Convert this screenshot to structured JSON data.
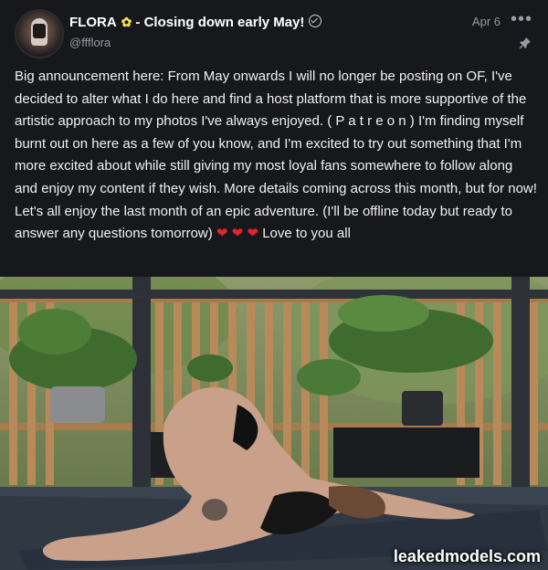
{
  "post": {
    "display_name": "FLORA",
    "display_name_suffix": "- Closing down early May!",
    "handle": "@ffflora",
    "date": "Apr 6",
    "body": "Big announcement here: From May onwards I will no longer be posting on OF, I've decided to alter what I do here and find a host platform that is more supportive of the artistic approach to my photos I've always enjoyed. ( P a t r e o n ) I'm finding myself burnt out on here as a few of you know, and I'm excited to try out something that I'm more excited about while still giving my most loyal fans somewhere to follow along and enjoy my content if they wish. More details coming across this month, but for now! Let's all enjoy the last month of an epic adventure. (I'll be offline today but ready to answer any questions tomorrow)",
    "body_end": "Love to you all",
    "flower_icon": "flower-emoji",
    "heart_icon": "red-heart-emoji"
  },
  "media": {
    "watermark": "leakedmodels.com"
  },
  "colors": {
    "background": "#17181c",
    "muted_text": "#9a9ba2",
    "heart": "#e3242b"
  }
}
